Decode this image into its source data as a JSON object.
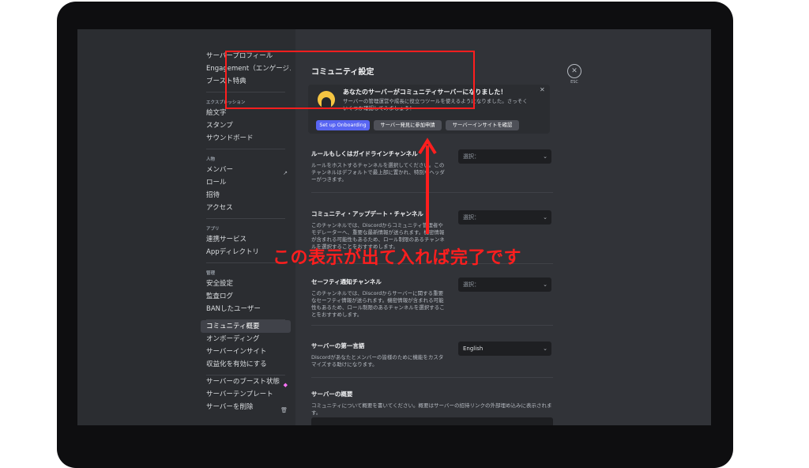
{
  "sidebar": {
    "group1": [
      "サーバープロフィール",
      "Engagement（エンゲージメ...",
      "ブースト特典"
    ],
    "group2_head": "エクスプレッション",
    "group2": [
      "絵文字",
      "スタンプ",
      "サウンドボード"
    ],
    "group3_head": "人物",
    "group3": [
      "メンバー",
      "ロール",
      "招待",
      "アクセス"
    ],
    "group4_head": "アプリ",
    "group4": [
      "連携サービス",
      "Appディレクトリ"
    ],
    "group5_head": "管理",
    "group5": [
      "安全設定",
      "監査ログ",
      "BANしたユーザー"
    ],
    "group6": [
      "コミュニティ概要",
      "オンボーディング",
      "サーバーインサイト",
      "収益化を有効にする"
    ],
    "group7": [
      "サーバーのブースト状態",
      "サーバーテンプレート",
      "サーバーを削除"
    ]
  },
  "content": {
    "page_title": "コミュニティ設定",
    "esc_label": "ESC",
    "esc_icon": "close-icon",
    "banner": {
      "title": "あなたのサーバーがコミュニティサーバーになりました！",
      "desc": "サーバーの管理運営や成長に役立つツールを使えるようになりました。さっそくいくつか確認してみましょう！",
      "btn_onboarding": "Set up Onboarding",
      "btn_discovery": "サーバー発見に参加申請",
      "btn_insights": "サーバーインサイトを確認"
    },
    "rules": {
      "label": "ルールもしくはガイドラインチャンネル",
      "desc": "ルールをホストするチャンネルを選択してください。このチャンネルはデフォルトで最上部に置かれ、特別なヘッダーがつきます。",
      "select": "選択："
    },
    "updates": {
      "label": "コミュニティ・アップデート・チャンネル",
      "desc": "このチャンネルでは、Discordからコミュニティ管理者やモデレーターへ、重要な最新情報が送られます。機密情報が含まれる可能性もあるため、ロール制限のあるチャンネルを選択することをおすすめします。",
      "select": "選択："
    },
    "safety": {
      "label": "セーフティ通知チャンネル",
      "desc": "このチャンネルでは、Discordからサーバーに関する重要なセーフティ情報が送られます。機密情報が含まれる可能性もあるため、ロール制限のあるチャンネルを選択することをおすすめします。",
      "select": "選択："
    },
    "language": {
      "label": "サーバーの第一言語",
      "desc": "Discordがあなたとメンバーの皆様のために機能をカスタマイズする助けになります。",
      "select": "English"
    },
    "overview": {
      "label": "サーバーの概要",
      "desc": "コミュニティについて概要を書いてください。概要はサーバーの招待リンクの外部埋め込みに表示されます。"
    }
  },
  "annotation": {
    "text": "この表示が出て入れば完了です",
    "color": "#ff1e1e"
  },
  "colors": {
    "accent": "#5865f2",
    "highlight": "#ff1e1e"
  }
}
